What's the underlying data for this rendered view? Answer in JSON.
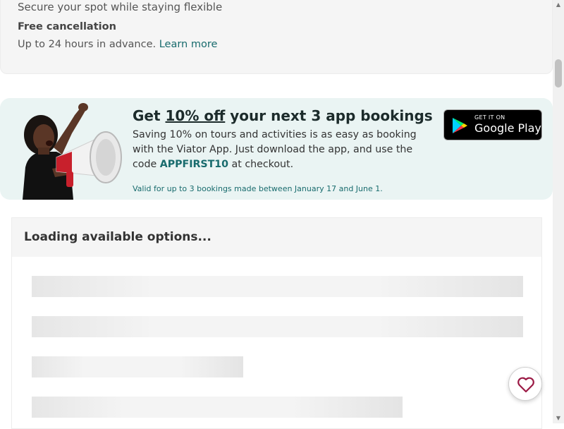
{
  "top_card": {
    "line1": "Secure your spot while staying flexible",
    "free_cancellation_title": "Free cancellation",
    "free_cancellation_text": "Up to 24 hours in advance.",
    "learn_more_link": "Learn more"
  },
  "promo": {
    "title_prefix": "Get ",
    "title_highlight": "10% off",
    "title_suffix": " your next 3 app bookings",
    "body_text": "Saving 10% on tours and activities is as easy as booking with the Viator App. Just download the app, and use the code ",
    "code": "APPFIRST10",
    "body_suffix": " at checkout.",
    "fine_print": "Valid for up to 3 bookings made between January 17 and June 1.",
    "illustration_icon": "woman-with-megaphone-image"
  },
  "google_play": {
    "small_text": "GET IT ON",
    "big_text": "Google Play",
    "icon": "google-play-icon"
  },
  "options": {
    "title": "Loading available options..."
  },
  "favorite": {
    "icon": "heart-icon",
    "color": "#9b1a45"
  },
  "colors": {
    "accent_teal": "#186b6d",
    "promo_bg": "#eaf4f3"
  }
}
